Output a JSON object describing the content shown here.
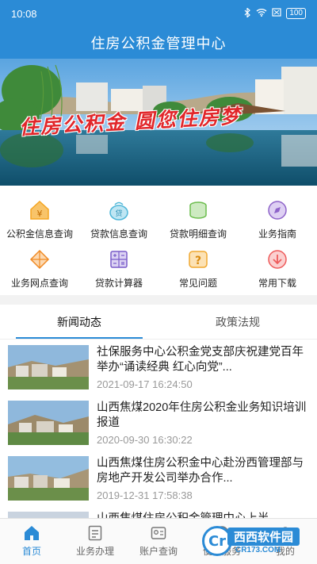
{
  "status_bar": {
    "time": "10:08",
    "battery": "100"
  },
  "header": {
    "title": "住房公积金管理中心"
  },
  "banner": {
    "slogan": "住房公积金 圆您住房梦"
  },
  "grid": [
    {
      "label": "公积金信息查询",
      "icon": "yuan-house-icon",
      "color": "#f5a623"
    },
    {
      "label": "贷款信息查询",
      "icon": "loan-bag-icon",
      "color": "#4db6d8"
    },
    {
      "label": "贷款明细查询",
      "icon": "money-stack-icon",
      "color": "#6cbd4e"
    },
    {
      "label": "业务指南",
      "icon": "compass-icon",
      "color": "#8e63c9"
    },
    {
      "label": "业务网点查询",
      "icon": "network-icon",
      "color": "#f08a24"
    },
    {
      "label": "贷款计算器",
      "icon": "calculator-icon",
      "color": "#7a5cc9"
    },
    {
      "label": "常见问题",
      "icon": "question-icon",
      "color": "#f0a830"
    },
    {
      "label": "常用下载",
      "icon": "download-icon",
      "color": "#ee5b5b"
    }
  ],
  "tabs": [
    {
      "label": "新闻动态"
    },
    {
      "label": "政策法规"
    }
  ],
  "news": [
    {
      "title": "社保服务中心公积金党支部庆祝建党百年 举办“诵读经典 红心向党”...",
      "time": "2021-09-17 16:24:50"
    },
    {
      "title": "山西焦煤2020年住房公积金业务知识培训报道",
      "time": "2020-09-30 16:30:22"
    },
    {
      "title": "山西焦煤住房公积金中心赴汾西管理部与房地产开发公司举办合作...",
      "time": "2019-12-31 17:58:38"
    },
    {
      "title": "山西焦煤住房公积金管理中心上半",
      "time": ""
    }
  ],
  "bottom_nav": [
    {
      "label": "首页",
      "icon": "home-icon"
    },
    {
      "label": "业务办理",
      "icon": "document-icon"
    },
    {
      "label": "账户查询",
      "icon": "account-icon"
    },
    {
      "label": "便民服务",
      "icon": "service-icon"
    },
    {
      "label": "我的",
      "icon": "profile-icon"
    }
  ],
  "watermark": {
    "brand": "西西软件园",
    "site": "CR173.COM"
  },
  "colors": {
    "primary": "#2b8bd6",
    "slogan": "#e1262a"
  }
}
